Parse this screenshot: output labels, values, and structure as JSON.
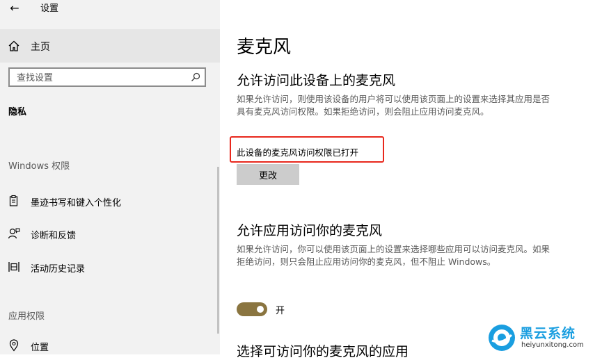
{
  "window": {
    "back_glyph": "←",
    "title": "设置"
  },
  "sidebar": {
    "home_label": "主页",
    "search_placeholder": "查找设置",
    "current_section": "隐私",
    "groups": [
      {
        "header": "Windows 权限"
      },
      {
        "header": "应用权限"
      }
    ],
    "items": [
      {
        "label": "墨迹书写和键入个性化",
        "icon": "pen-clipboard-icon"
      },
      {
        "label": "诊断和反馈",
        "icon": "person-feedback-icon"
      },
      {
        "label": "活动历史记录",
        "icon": "activity-history-icon"
      },
      {
        "label": "位置",
        "icon": "location-icon"
      }
    ]
  },
  "main": {
    "title": "麦克风",
    "device_section": {
      "heading": "允许访问此设备上的麦克风",
      "description": "如果允许访问，则使用该设备的用户将可以使用该页面上的设置来选择其应用是否具有麦克风访问权限。如果拒绝访问，则会阻止应用访问麦克风。",
      "status": "此设备的麦克风访问权限已打开",
      "change_button": "更改"
    },
    "apps_section": {
      "heading": "允许应用访问你的麦克风",
      "description": "如果允许访问，你可以使用该页面上的设置来选择哪些应用可以访问麦克风。如果拒绝访问，则只会阻止应用访问你的麦克风，但不阻止 Windows。",
      "toggle_state": "开",
      "toggle_on": true
    },
    "choose_section": {
      "heading": "选择可访问你的麦克风的应用"
    }
  },
  "colors": {
    "accent": "#8a7540",
    "highlight": "#e8271c"
  },
  "watermark": {
    "title": "黑云系统",
    "url": "heiyunxitong.com"
  }
}
